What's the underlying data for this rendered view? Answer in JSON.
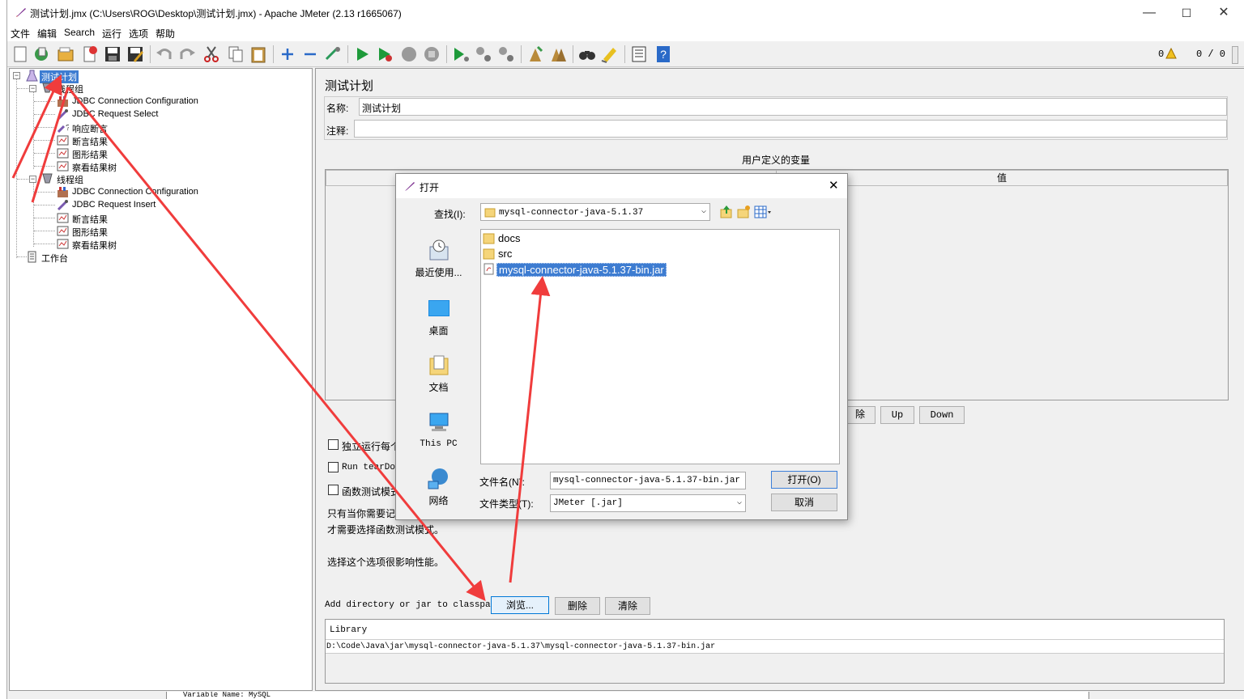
{
  "window": {
    "title": "测试计划.jmx (C:\\Users\\ROG\\Desktop\\测试计划.jmx) - Apache JMeter (2.13 r1665067)"
  },
  "menu": [
    "文件",
    "编辑",
    "Search",
    "运行",
    "选项",
    "帮助"
  ],
  "toolbar": {
    "warnings_count": "0",
    "threads": "0 / 0"
  },
  "tree": {
    "root": "测试计划",
    "group1": "线程组",
    "g1_items": [
      "JDBC Connection Configuration",
      "JDBC Request Select",
      "响应断言",
      "断言结果",
      "图形结果",
      "察看结果树"
    ],
    "group2": "线程组",
    "g2_items": [
      "JDBC Connection Configuration",
      "JDBC Request Insert",
      "断言结果",
      "图形结果",
      "察看结果树"
    ],
    "workbench": "工作台"
  },
  "testplan": {
    "heading": "测试计划",
    "name_label": "名称:",
    "name_value": "测试计划",
    "comment_label": "注释:",
    "comment_value": "",
    "udv_title": "用户定义的变量",
    "udv_col2": "值",
    "btn_partial": "除",
    "btn_up": "Up",
    "btn_down": "Down",
    "cb1": "独立运行每个",
    "cb2": "Run tearDow",
    "cb3": "函数测试模式",
    "note1": "只有当你需要记",
    "note2": "才需要选择函数测试模式。",
    "note3": "选择这个选项很影响性能。",
    "classpath_label": "Add directory or jar to classpath",
    "btn_browse": "浏览...",
    "btn_delete": "删除",
    "btn_clear": "清除",
    "lib_header": "Library",
    "lib_row": "D:\\Code\\Java\\jar\\mysql-connector-java-5.1.37\\mysql-connector-java-5.1.37-bin.jar"
  },
  "dialog": {
    "title": "打开",
    "lookin_label": "查找(I):",
    "lookin_value": "mysql-connector-java-5.1.37",
    "places": [
      "最近使用...",
      "桌面",
      "文档",
      "This PC",
      "网络"
    ],
    "files": [
      {
        "name": "docs",
        "type": "folder"
      },
      {
        "name": "src",
        "type": "folder"
      },
      {
        "name": "mysql-connector-java-5.1.37-bin.jar",
        "type": "jar"
      }
    ],
    "filename_label": "文件名(N):",
    "filename_value": "mysql-connector-java-5.1.37-bin.jar",
    "filetype_label": "文件类型(T):",
    "filetype_value": "JMeter [.jar]",
    "btn_open": "打开(O)",
    "btn_cancel": "取消"
  },
  "bottom_snippet": "Variable Name: MySQL",
  "colors": {
    "selection": "#3d7cd1",
    "arrow": "#f03c3c"
  }
}
